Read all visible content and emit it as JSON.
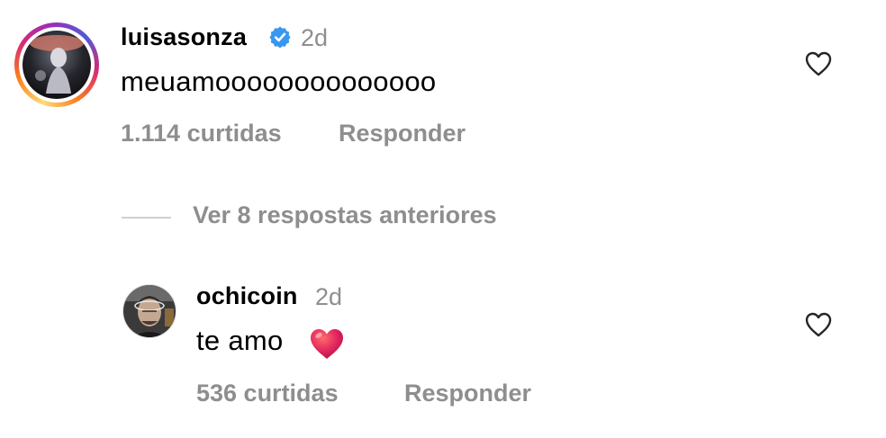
{
  "comment": {
    "username": "luisasonza",
    "verified": true,
    "time": "2d",
    "text": "meuamoooooooooooooo",
    "likes": "1.114 curtidas",
    "reply_label": "Responder",
    "like_icon": "heart-outline-icon"
  },
  "replies_toggle": {
    "label": "Ver 8 respostas anteriores"
  },
  "reply": {
    "username": "ochicoin",
    "time": "2d",
    "text": "te amo",
    "emoji": "❤️",
    "likes": "536 curtidas",
    "reply_label": "Responder",
    "like_icon": "heart-outline-icon"
  },
  "colors": {
    "secondary_text": "#8e8e8e",
    "verified_badge": "#3897f0",
    "heart_emoji": "#e0245e"
  }
}
